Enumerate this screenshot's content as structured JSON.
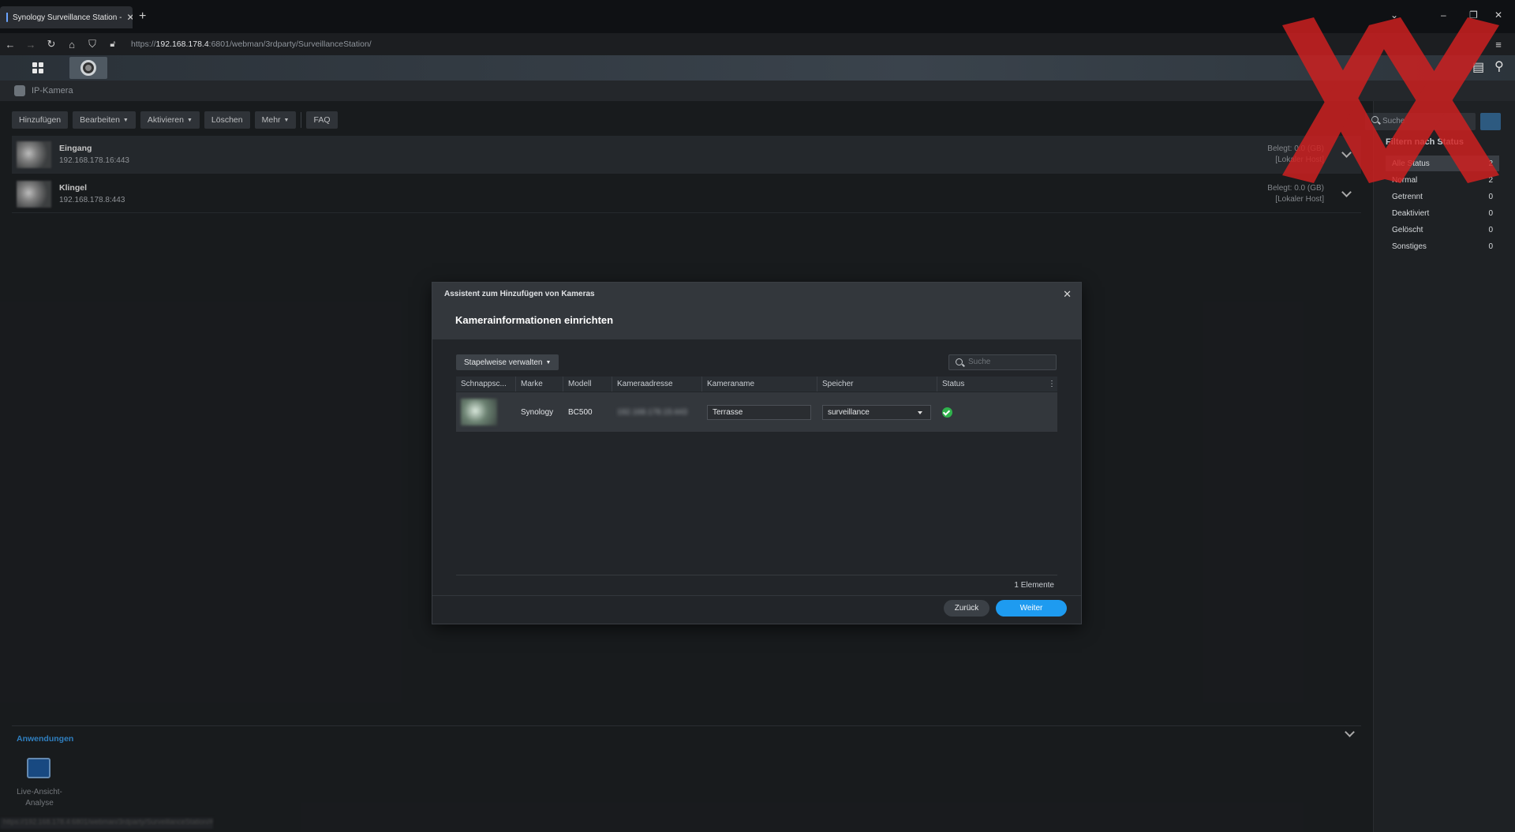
{
  "browser": {
    "tab_title": "Synology Surveillance Station -",
    "url_prefix": "https://",
    "url_host": "192.168.178.4",
    "url_path": ":6801/webman/3rdparty/SurveillanceStation/"
  },
  "window": {
    "title": "IP-Kamera"
  },
  "toolbar": {
    "add": "Hinzufügen",
    "edit": "Bearbeiten",
    "activate": "Aktivieren",
    "delete": "Löschen",
    "more": "Mehr",
    "faq": "FAQ"
  },
  "cameras": [
    {
      "name": "Eingang",
      "ip": "192.168.178.16:443",
      "storage_used": "Belegt: 0.0 (GB)",
      "host": "[Lokaler Host]"
    },
    {
      "name": "Klingel",
      "ip": "192.168.178.8:443",
      "storage_used": "Belegt: 0.0 (GB)",
      "host": "[Lokaler Host]"
    }
  ],
  "sidebar": {
    "search_placeholder": "Suche",
    "filter_title": "Filtern nach Status",
    "filters": [
      {
        "label": "Alle Status",
        "count": "2"
      },
      {
        "label": "Normal",
        "count": "2"
      },
      {
        "label": "Getrennt",
        "count": "0"
      },
      {
        "label": "Deaktiviert",
        "count": "0"
      },
      {
        "label": "Gelöscht",
        "count": "0"
      },
      {
        "label": "Sonstiges",
        "count": "0"
      }
    ]
  },
  "applications": {
    "title": "Anwendungen",
    "items": [
      {
        "label": "Live-Ansicht-Analyse"
      }
    ]
  },
  "dialog": {
    "wizard_title": "Assistent zum Hinzufügen von Kameras",
    "title": "Kamerainformationen einrichten",
    "batch_button": "Stapelweise verwalten",
    "search_placeholder": "Suche",
    "columns": [
      "Schnappsc...",
      "Marke",
      "Modell",
      "Kameraadresse",
      "Kameraname",
      "Speicher",
      "Status"
    ],
    "rows": [
      {
        "brand": "Synology",
        "model": "BC500",
        "address": "192.168.178.15:443",
        "name": "Terrasse",
        "storage": "surveillance",
        "status": "ok"
      }
    ],
    "count": "1 Elemente",
    "back": "Zurück",
    "next": "Weiter"
  },
  "colors": {
    "accent": "#1e9bf0",
    "link": "#3a9bea",
    "ok": "#2fb24c",
    "overlay_x": "#d32020"
  }
}
